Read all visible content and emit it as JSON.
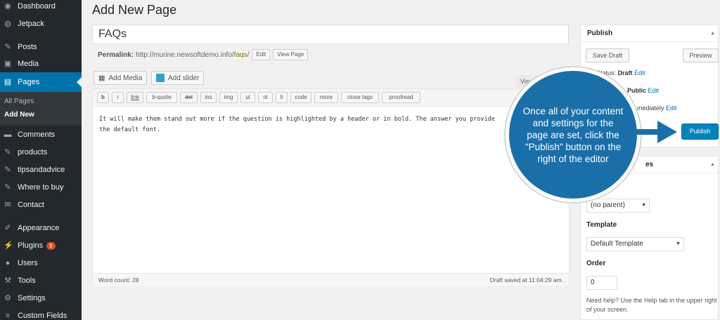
{
  "sidebar": {
    "items": [
      {
        "label": "Dashboard",
        "icon": "dashboard-icon",
        "glyph": "◉"
      },
      {
        "label": "Jetpack",
        "icon": "jetpack-icon",
        "glyph": "◍"
      },
      {
        "label": "Posts",
        "icon": "pin-icon",
        "glyph": "✎"
      },
      {
        "label": "Media",
        "icon": "media-icon",
        "glyph": "▣"
      },
      {
        "label": "Pages",
        "icon": "pages-icon",
        "glyph": "▤"
      },
      {
        "label": "Comments",
        "icon": "comments-icon",
        "glyph": "▬"
      },
      {
        "label": "products",
        "icon": "pin-icon",
        "glyph": "✎"
      },
      {
        "label": "tipsandadvice",
        "icon": "pin-icon",
        "glyph": "✎"
      },
      {
        "label": "Where to buy",
        "icon": "pin-icon",
        "glyph": "✎"
      },
      {
        "label": "Contact",
        "icon": "mail-icon",
        "glyph": "✉"
      },
      {
        "label": "Appearance",
        "icon": "brush-icon",
        "glyph": "✐"
      },
      {
        "label": "Plugins",
        "icon": "plugin-icon",
        "glyph": "⚡",
        "badge": "8"
      },
      {
        "label": "Users",
        "icon": "users-icon",
        "glyph": "●"
      },
      {
        "label": "Tools",
        "icon": "wrench-icon",
        "glyph": "⚒"
      },
      {
        "label": "Settings",
        "icon": "settings-icon",
        "glyph": "⚙"
      },
      {
        "label": "Custom Fields",
        "icon": "custom-fields-icon",
        "glyph": "≡"
      }
    ],
    "submenu": {
      "all_pages": "All Pages",
      "add_new": "Add New"
    }
  },
  "main": {
    "page_title": "Add New Page",
    "title_value": "FAQs",
    "permalink": {
      "label": "Permalink:",
      "url_prefix": "http://murine.newsoftdemo.info/",
      "slug": "faqs",
      "url_suffix": "/",
      "edit": "Edit",
      "view_page": "View Page"
    },
    "add_media": "Add Media",
    "add_slider": "Add slider",
    "visual_tab": "Visu",
    "quicktags": [
      "b",
      "i",
      "link",
      "b-quote",
      "del",
      "ins",
      "img",
      "ul",
      "ol",
      "li",
      "code",
      "more",
      "close tags",
      "proofread"
    ],
    "content": "It will make them stand out more if the question is highlighted by a header or in bold. The answer you provide\nthe default font.",
    "word_count": "Word count: 28",
    "draft_saved": "Draft saved at 11:04:29 am."
  },
  "publish": {
    "title": "Publish",
    "save_draft": "Save Draft",
    "preview": "Preview",
    "status_label": "Status:",
    "status_value": "Draft",
    "visibility_value": "Public",
    "schedule_text": "mediately",
    "edit": "Edit",
    "publish": "Publish"
  },
  "attributes": {
    "title_partial": "es",
    "parent_select": "(no parent)",
    "template_label": "Template",
    "template_select": "Default Template",
    "order_label": "Order",
    "order_value": "0",
    "help": "Need help? Use the Help tab in the upper right of your screen."
  },
  "callout": {
    "text": "Once all of your content and settings for the page are set, click the \"Publish\" button on the right of the editor"
  },
  "colors": {
    "sidebar": "#23282d",
    "accent": "#0073aa",
    "publish": "#0085ba",
    "callout": "#1b6fa9"
  }
}
